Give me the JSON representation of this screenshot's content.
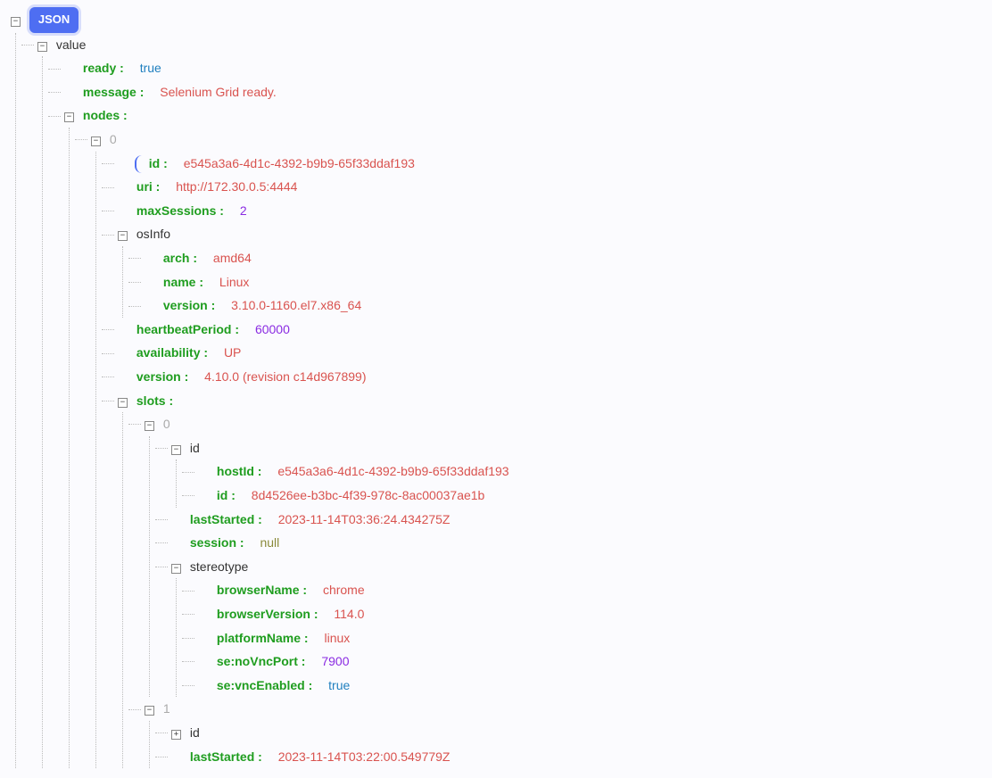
{
  "root": {
    "badge": "JSON"
  },
  "value": {
    "label": "value",
    "ready": {
      "key": "ready",
      "value": "true",
      "type": "bool"
    },
    "message": {
      "key": "message",
      "value": "Selenium Grid ready.",
      "type": "str"
    },
    "nodes": {
      "key": "nodes",
      "items": [
        {
          "index": "0",
          "id": {
            "key": "id",
            "value": "e545a3a6-4d1c-4392-b9b9-65f33ddaf193",
            "type": "str"
          },
          "uri": {
            "key": "uri",
            "value": "http://172.30.0.5:4444",
            "type": "str"
          },
          "maxSessions": {
            "key": "maxSessions",
            "value": "2",
            "type": "num"
          },
          "osInfo": {
            "label": "osInfo",
            "arch": {
              "key": "arch",
              "value": "amd64",
              "type": "str"
            },
            "name": {
              "key": "name",
              "value": "Linux",
              "type": "str"
            },
            "version": {
              "key": "version",
              "value": "3.10.0-1160.el7.x86_64",
              "type": "str"
            }
          },
          "heartbeatPeriod": {
            "key": "heartbeatPeriod",
            "value": "60000",
            "type": "num"
          },
          "availability": {
            "key": "availability",
            "value": "UP",
            "type": "str"
          },
          "version": {
            "key": "version",
            "value": "4.10.0 (revision c14d967899)",
            "type": "str"
          },
          "slots": {
            "key": "slots",
            "items": [
              {
                "index": "0",
                "id": {
                  "label": "id",
                  "hostId": {
                    "key": "hostId",
                    "value": "e545a3a6-4d1c-4392-b9b9-65f33ddaf193",
                    "type": "str"
                  },
                  "id": {
                    "key": "id",
                    "value": "8d4526ee-b3bc-4f39-978c-8ac00037ae1b",
                    "type": "str"
                  }
                },
                "lastStarted": {
                  "key": "lastStarted",
                  "value": "2023-11-14T03:36:24.434275Z",
                  "type": "str"
                },
                "session": {
                  "key": "session",
                  "value": "null",
                  "type": "null"
                },
                "stereotype": {
                  "label": "stereotype",
                  "browserName": {
                    "key": "browserName",
                    "value": "chrome",
                    "type": "str"
                  },
                  "browserVersion": {
                    "key": "browserVersion",
                    "value": "114.0",
                    "type": "str"
                  },
                  "platformName": {
                    "key": "platformName",
                    "value": "linux",
                    "type": "str"
                  },
                  "seNoVncPort": {
                    "key": "se:noVncPort",
                    "value": "7900",
                    "type": "num"
                  },
                  "seVncEnabled": {
                    "key": "se:vncEnabled",
                    "value": "true",
                    "type": "bool"
                  }
                }
              },
              {
                "index": "1",
                "id": {
                  "label": "id"
                },
                "lastStarted": {
                  "key": "lastStarted",
                  "value": "2023-11-14T03:22:00.549779Z",
                  "type": "str"
                }
              }
            ]
          }
        }
      ]
    }
  }
}
